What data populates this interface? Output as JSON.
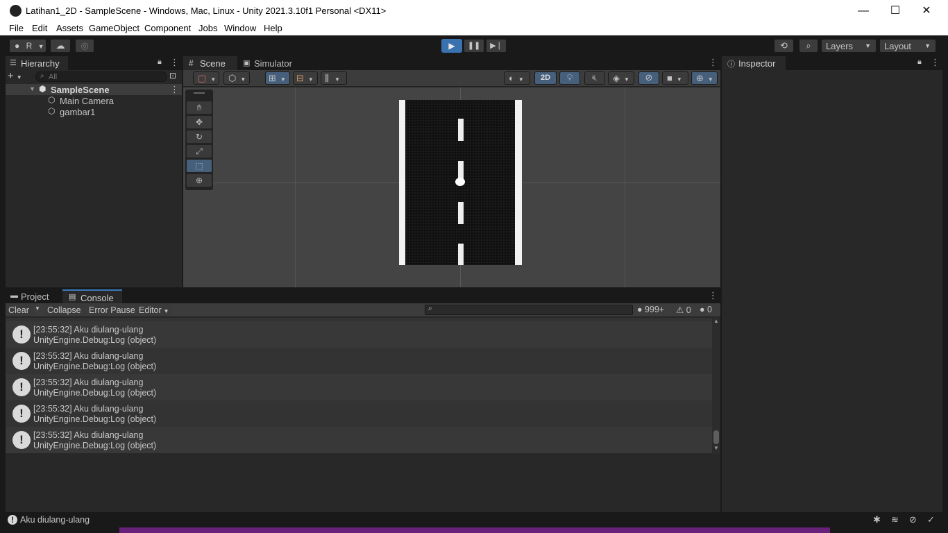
{
  "window": {
    "title": "Latihan1_2D - SampleScene - Windows, Mac, Linux - Unity 2021.3.10f1 Personal <DX11>",
    "minimize": "—",
    "maximize": "☐",
    "close": "✕"
  },
  "menu": [
    "File",
    "Edit",
    "Assets",
    "GameObject",
    "Component",
    "Jobs",
    "Window",
    "Help"
  ],
  "toolbar": {
    "account": "R",
    "layers": "Layers",
    "layout": "Layout"
  },
  "hierarchy": {
    "tab": "Hierarchy",
    "search_placeholder": "All",
    "scene": "SampleScene",
    "items": [
      "Main Camera",
      "gambar1"
    ]
  },
  "scene_view": {
    "tabs": [
      "Scene",
      "Simulator"
    ],
    "mode_2d": "2D"
  },
  "inspector": {
    "tab": "Inspector"
  },
  "bottom": {
    "tabs": [
      "Project",
      "Console"
    ],
    "clear": "Clear",
    "collapse": "Collapse",
    "error_pause": "Error Pause",
    "editor": "Editor",
    "counts": {
      "logs": "999+",
      "warnings": "0",
      "errors": "0"
    },
    "entries": [
      {
        "line1": "[23:55:32] Aku diulang-ulang",
        "line2": "UnityEngine.Debug:Log (object)"
      },
      {
        "line1": "[23:55:32] Aku diulang-ulang",
        "line2": "UnityEngine.Debug:Log (object)"
      },
      {
        "line1": "[23:55:32] Aku diulang-ulang",
        "line2": "UnityEngine.Debug:Log (object)"
      },
      {
        "line1": "[23:55:32] Aku diulang-ulang",
        "line2": "UnityEngine.Debug:Log (object)"
      },
      {
        "line1": "[23:55:32] Aku diulang-ulang",
        "line2": "UnityEngine.Debug:Log (object)"
      }
    ]
  },
  "status": {
    "message": "Aku diulang-ulang"
  },
  "colors": {
    "accent": "#46607c",
    "play_active": "#3a72b0",
    "panel": "#282828"
  }
}
